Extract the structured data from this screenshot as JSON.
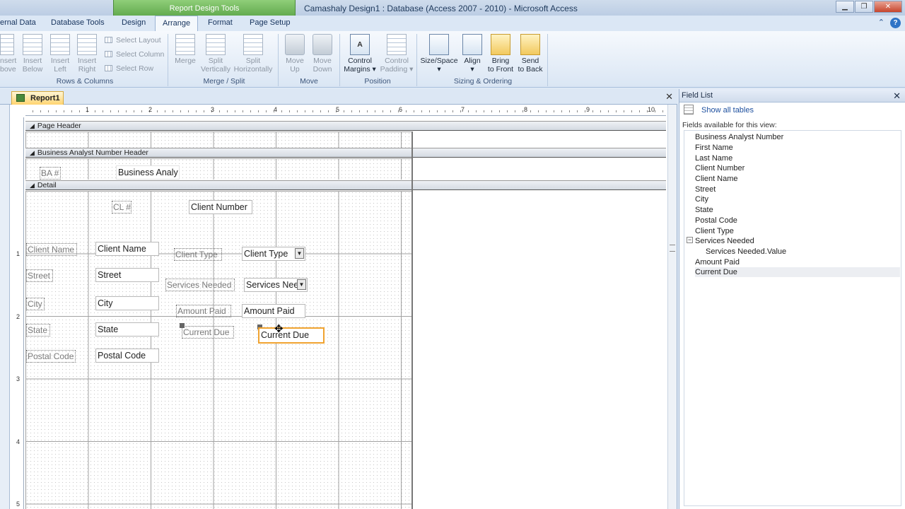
{
  "window": {
    "title": "Camashaly Design1 : Database (Access 2007 - 2010)  -  Microsoft Access",
    "context_tab": "Report Design Tools"
  },
  "tabs": [
    "ernal Data",
    "Database Tools",
    "Design",
    "Arrange",
    "Format",
    "Page Setup"
  ],
  "ribbon": {
    "rows_columns": {
      "insert_above": [
        "nsert",
        "bove"
      ],
      "insert_below": [
        "Insert",
        "Below"
      ],
      "insert_left": [
        "Insert",
        "Left"
      ],
      "insert_right": [
        "Insert",
        "Right"
      ],
      "select_layout": "Select Layout",
      "select_column": "Select Column",
      "select_row": "Select Row",
      "group_label": "Rows & Columns"
    },
    "merge_split": {
      "merge": "Merge",
      "split_vertically": [
        "Split",
        "Vertically"
      ],
      "split_horizontally": [
        "Split",
        "Horizontally"
      ],
      "group_label": "Merge / Split"
    },
    "move": {
      "move_up": [
        "Move",
        "Up"
      ],
      "move_down": [
        "Move",
        "Down"
      ],
      "group_label": "Move"
    },
    "position": {
      "control_margins": [
        "Control",
        "Margins"
      ],
      "control_padding": [
        "Control",
        "Padding"
      ],
      "group_label": "Position"
    },
    "sizing": {
      "size_space": "Size/Space",
      "align": "Align",
      "bring_to_front": [
        "Bring",
        "to Front"
      ],
      "send_to_back": [
        "Send",
        "to Back"
      ],
      "group_label": "Sizing & Ordering"
    }
  },
  "document": {
    "tab": "Report1",
    "ruler_numbers": [
      "1",
      "2",
      "3",
      "4",
      "5",
      "6",
      "7",
      "8",
      "9",
      "10"
    ],
    "vruler_numbers": [
      "1",
      "2",
      "3",
      "4",
      "5"
    ],
    "sections": {
      "page_header": "Page Header",
      "group_header": "Business Analyst Number Header",
      "detail": "Detail"
    },
    "controls": {
      "ba_label": "BA #",
      "ba_text": "Business Analy",
      "cl_label": "CL #",
      "client_number": "Client Number",
      "client_name_label": "Client Name",
      "client_name": "Client Name",
      "client_type_label": "Client Type",
      "client_type": "Client Type",
      "street_label": "Street",
      "street": "Street",
      "services_label": "Services Needed",
      "services": "Services Nee",
      "city_label": "City",
      "city": "City",
      "amount_paid_label": "Amount Paid",
      "amount_paid": "Amount Paid",
      "state_label": "State",
      "state": "State",
      "current_due_label": "Current Due",
      "current_due": "Current Due",
      "postal_label": "Postal Code",
      "postal": "Postal Code"
    }
  },
  "field_list": {
    "title": "Field List",
    "show_all": "Show all tables",
    "caption": "Fields available for this view:",
    "fields": [
      "Business Analyst Number",
      "First Name",
      "Last Name",
      "Client Number",
      "Client Name",
      "Street",
      "City",
      "State",
      "Postal Code",
      "Client Type",
      "Services Needed",
      "Services Needed.Value",
      "Amount Paid",
      "Current Due"
    ],
    "expander": "−"
  }
}
